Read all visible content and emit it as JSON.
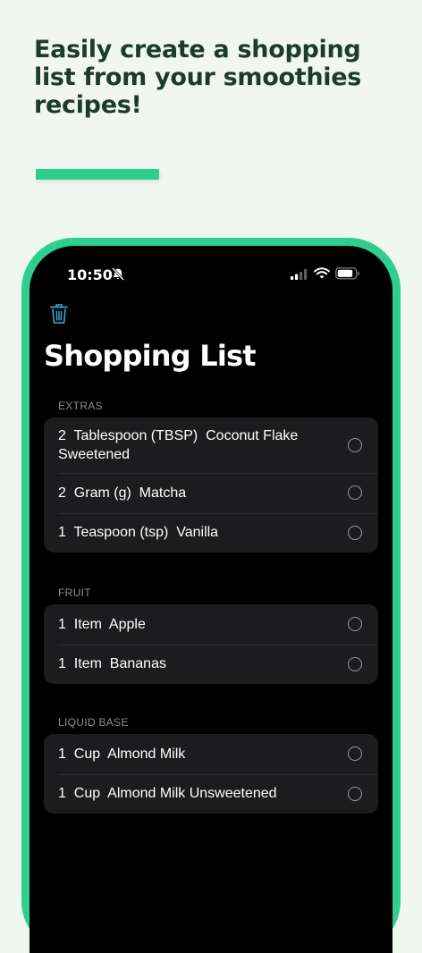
{
  "marketing": {
    "headline": "Easily create a shopping list from your smoothies recipes!",
    "accent_color": "#2ecf8c"
  },
  "status_bar": {
    "time": "10:50",
    "icons": [
      "bell-slash-icon",
      "cellular-signal-icon",
      "wifi-icon",
      "battery-icon"
    ]
  },
  "toolbar": {
    "delete_icon": "trash-icon"
  },
  "page": {
    "title": "Shopping List"
  },
  "sections": [
    {
      "header": "EXTRAS",
      "items": [
        {
          "text": "2  Tablespoon (TBSP)  Coconut Flake Sweetened",
          "checked": false
        },
        {
          "text": "2  Gram (g)  Matcha",
          "checked": false
        },
        {
          "text": "1  Teaspoon (tsp)  Vanilla",
          "checked": false
        }
      ]
    },
    {
      "header": "FRUIT",
      "items": [
        {
          "text": "1  Item  Apple",
          "checked": false
        },
        {
          "text": "1  Item  Bananas",
          "checked": false
        }
      ]
    },
    {
      "header": "LIQUID BASE",
      "items": [
        {
          "text": "1  Cup  Almond Milk",
          "checked": false
        },
        {
          "text": "1  Cup  Almond Milk Unsweetened",
          "checked": false
        }
      ]
    }
  ]
}
